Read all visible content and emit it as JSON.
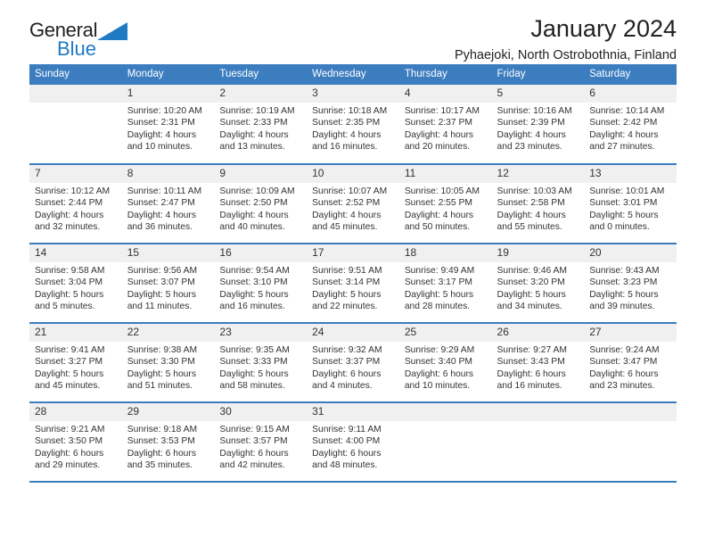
{
  "brand": {
    "name_part1": "General",
    "name_part2": "Blue",
    "triangle_color": "#1f7ac4",
    "text_color": "#231f20"
  },
  "header": {
    "title": "January 2024",
    "subtitle": "Pyhaejoki, North Ostrobothnia, Finland"
  },
  "colors": {
    "header_row_bg": "#3b7dbf",
    "header_row_text": "#ffffff",
    "daynum_bg": "#f0f0f0",
    "row_separator": "#3b7dbf",
    "body_text": "#333333"
  },
  "weekdays": [
    "Sunday",
    "Monday",
    "Tuesday",
    "Wednesday",
    "Thursday",
    "Friday",
    "Saturday"
  ],
  "weeks": [
    [
      {
        "day": "",
        "empty": true,
        "sunrise": "",
        "sunset": "",
        "daylight_line1": "",
        "daylight_line2": ""
      },
      {
        "day": "1",
        "sunrise": "Sunrise: 10:20 AM",
        "sunset": "Sunset: 2:31 PM",
        "daylight_line1": "Daylight: 4 hours",
        "daylight_line2": "and 10 minutes."
      },
      {
        "day": "2",
        "sunrise": "Sunrise: 10:19 AM",
        "sunset": "Sunset: 2:33 PM",
        "daylight_line1": "Daylight: 4 hours",
        "daylight_line2": "and 13 minutes."
      },
      {
        "day": "3",
        "sunrise": "Sunrise: 10:18 AM",
        "sunset": "Sunset: 2:35 PM",
        "daylight_line1": "Daylight: 4 hours",
        "daylight_line2": "and 16 minutes."
      },
      {
        "day": "4",
        "sunrise": "Sunrise: 10:17 AM",
        "sunset": "Sunset: 2:37 PM",
        "daylight_line1": "Daylight: 4 hours",
        "daylight_line2": "and 20 minutes."
      },
      {
        "day": "5",
        "sunrise": "Sunrise: 10:16 AM",
        "sunset": "Sunset: 2:39 PM",
        "daylight_line1": "Daylight: 4 hours",
        "daylight_line2": "and 23 minutes."
      },
      {
        "day": "6",
        "sunrise": "Sunrise: 10:14 AM",
        "sunset": "Sunset: 2:42 PM",
        "daylight_line1": "Daylight: 4 hours",
        "daylight_line2": "and 27 minutes."
      }
    ],
    [
      {
        "day": "7",
        "sunrise": "Sunrise: 10:12 AM",
        "sunset": "Sunset: 2:44 PM",
        "daylight_line1": "Daylight: 4 hours",
        "daylight_line2": "and 32 minutes."
      },
      {
        "day": "8",
        "sunrise": "Sunrise: 10:11 AM",
        "sunset": "Sunset: 2:47 PM",
        "daylight_line1": "Daylight: 4 hours",
        "daylight_line2": "and 36 minutes."
      },
      {
        "day": "9",
        "sunrise": "Sunrise: 10:09 AM",
        "sunset": "Sunset: 2:50 PM",
        "daylight_line1": "Daylight: 4 hours",
        "daylight_line2": "and 40 minutes."
      },
      {
        "day": "10",
        "sunrise": "Sunrise: 10:07 AM",
        "sunset": "Sunset: 2:52 PM",
        "daylight_line1": "Daylight: 4 hours",
        "daylight_line2": "and 45 minutes."
      },
      {
        "day": "11",
        "sunrise": "Sunrise: 10:05 AM",
        "sunset": "Sunset: 2:55 PM",
        "daylight_line1": "Daylight: 4 hours",
        "daylight_line2": "and 50 minutes."
      },
      {
        "day": "12",
        "sunrise": "Sunrise: 10:03 AM",
        "sunset": "Sunset: 2:58 PM",
        "daylight_line1": "Daylight: 4 hours",
        "daylight_line2": "and 55 minutes."
      },
      {
        "day": "13",
        "sunrise": "Sunrise: 10:01 AM",
        "sunset": "Sunset: 3:01 PM",
        "daylight_line1": "Daylight: 5 hours",
        "daylight_line2": "and 0 minutes."
      }
    ],
    [
      {
        "day": "14",
        "sunrise": "Sunrise: 9:58 AM",
        "sunset": "Sunset: 3:04 PM",
        "daylight_line1": "Daylight: 5 hours",
        "daylight_line2": "and 5 minutes."
      },
      {
        "day": "15",
        "sunrise": "Sunrise: 9:56 AM",
        "sunset": "Sunset: 3:07 PM",
        "daylight_line1": "Daylight: 5 hours",
        "daylight_line2": "and 11 minutes."
      },
      {
        "day": "16",
        "sunrise": "Sunrise: 9:54 AM",
        "sunset": "Sunset: 3:10 PM",
        "daylight_line1": "Daylight: 5 hours",
        "daylight_line2": "and 16 minutes."
      },
      {
        "day": "17",
        "sunrise": "Sunrise: 9:51 AM",
        "sunset": "Sunset: 3:14 PM",
        "daylight_line1": "Daylight: 5 hours",
        "daylight_line2": "and 22 minutes."
      },
      {
        "day": "18",
        "sunrise": "Sunrise: 9:49 AM",
        "sunset": "Sunset: 3:17 PM",
        "daylight_line1": "Daylight: 5 hours",
        "daylight_line2": "and 28 minutes."
      },
      {
        "day": "19",
        "sunrise": "Sunrise: 9:46 AM",
        "sunset": "Sunset: 3:20 PM",
        "daylight_line1": "Daylight: 5 hours",
        "daylight_line2": "and 34 minutes."
      },
      {
        "day": "20",
        "sunrise": "Sunrise: 9:43 AM",
        "sunset": "Sunset: 3:23 PM",
        "daylight_line1": "Daylight: 5 hours",
        "daylight_line2": "and 39 minutes."
      }
    ],
    [
      {
        "day": "21",
        "sunrise": "Sunrise: 9:41 AM",
        "sunset": "Sunset: 3:27 PM",
        "daylight_line1": "Daylight: 5 hours",
        "daylight_line2": "and 45 minutes."
      },
      {
        "day": "22",
        "sunrise": "Sunrise: 9:38 AM",
        "sunset": "Sunset: 3:30 PM",
        "daylight_line1": "Daylight: 5 hours",
        "daylight_line2": "and 51 minutes."
      },
      {
        "day": "23",
        "sunrise": "Sunrise: 9:35 AM",
        "sunset": "Sunset: 3:33 PM",
        "daylight_line1": "Daylight: 5 hours",
        "daylight_line2": "and 58 minutes."
      },
      {
        "day": "24",
        "sunrise": "Sunrise: 9:32 AM",
        "sunset": "Sunset: 3:37 PM",
        "daylight_line1": "Daylight: 6 hours",
        "daylight_line2": "and 4 minutes."
      },
      {
        "day": "25",
        "sunrise": "Sunrise: 9:29 AM",
        "sunset": "Sunset: 3:40 PM",
        "daylight_line1": "Daylight: 6 hours",
        "daylight_line2": "and 10 minutes."
      },
      {
        "day": "26",
        "sunrise": "Sunrise: 9:27 AM",
        "sunset": "Sunset: 3:43 PM",
        "daylight_line1": "Daylight: 6 hours",
        "daylight_line2": "and 16 minutes."
      },
      {
        "day": "27",
        "sunrise": "Sunrise: 9:24 AM",
        "sunset": "Sunset: 3:47 PM",
        "daylight_line1": "Daylight: 6 hours",
        "daylight_line2": "and 23 minutes."
      }
    ],
    [
      {
        "day": "28",
        "sunrise": "Sunrise: 9:21 AM",
        "sunset": "Sunset: 3:50 PM",
        "daylight_line1": "Daylight: 6 hours",
        "daylight_line2": "and 29 minutes."
      },
      {
        "day": "29",
        "sunrise": "Sunrise: 9:18 AM",
        "sunset": "Sunset: 3:53 PM",
        "daylight_line1": "Daylight: 6 hours",
        "daylight_line2": "and 35 minutes."
      },
      {
        "day": "30",
        "sunrise": "Sunrise: 9:15 AM",
        "sunset": "Sunset: 3:57 PM",
        "daylight_line1": "Daylight: 6 hours",
        "daylight_line2": "and 42 minutes."
      },
      {
        "day": "31",
        "sunrise": "Sunrise: 9:11 AM",
        "sunset": "Sunset: 4:00 PM",
        "daylight_line1": "Daylight: 6 hours",
        "daylight_line2": "and 48 minutes."
      },
      {
        "day": "",
        "empty": true,
        "sunrise": "",
        "sunset": "",
        "daylight_line1": "",
        "daylight_line2": ""
      },
      {
        "day": "",
        "empty": true,
        "sunrise": "",
        "sunset": "",
        "daylight_line1": "",
        "daylight_line2": ""
      },
      {
        "day": "",
        "empty": true,
        "sunrise": "",
        "sunset": "",
        "daylight_line1": "",
        "daylight_line2": ""
      }
    ]
  ]
}
